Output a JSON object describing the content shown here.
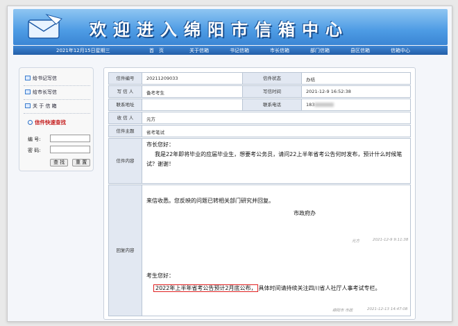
{
  "banner": {
    "title": "欢迎进入绵阳市信箱中心"
  },
  "navbar": {
    "date": "2021年12月15日星期三",
    "items": [
      "首　页",
      "关于信箱",
      "书记信箱",
      "市长信箱",
      "部门信箱",
      "县区信箱",
      "信箱中心"
    ]
  },
  "sidebar": {
    "links": [
      "给书记写信",
      "给市长写信",
      "关 于 信 箱"
    ],
    "quick_title": "信件快速查找",
    "number_label": "编 号:",
    "password_label": "密 码:",
    "search_button": "查 找",
    "reset_button": "重 置"
  },
  "letter": {
    "number_label": "信件编号",
    "number": "20211209033",
    "status_label": "信件状态",
    "status": "办结",
    "writer_label": "写 信 人",
    "writer": "备考考生",
    "time_label": "写信时间",
    "time": "2021-12-9 16:52:38",
    "address_label": "联系地址",
    "phone_label": "联系电话",
    "phone_prefix": "183",
    "recipient_label": "收 信 人",
    "recipient": "元方",
    "subject_label": "信件主题",
    "subject": "省考笔试",
    "content_label": "信件内容",
    "content_greeting": "市长您好：",
    "content_body": "我是22年即将毕业的应届毕业生，想要考公务员，请问22上半年省考公告何时发布，预计什么时候笔试？谢谢！",
    "reply_label": "回复内容",
    "reply1_text": "来信收悉。您反映的问题已转相关部门研究并回复。",
    "reply1_sign": "市政府办",
    "reply1_person": "元方",
    "reply1_time": "2021-12-9 9:11:38",
    "reply2_greeting": "考生您好：",
    "reply2_highlight": "2022年上半年省考公告预计2月底公布，",
    "reply2_rest": "具体时间请持续关注四川省人社厅人事考试专栏。",
    "reply2_person": "绵阳市 市政",
    "reply2_time": "2021-12-13 14:47:08"
  }
}
